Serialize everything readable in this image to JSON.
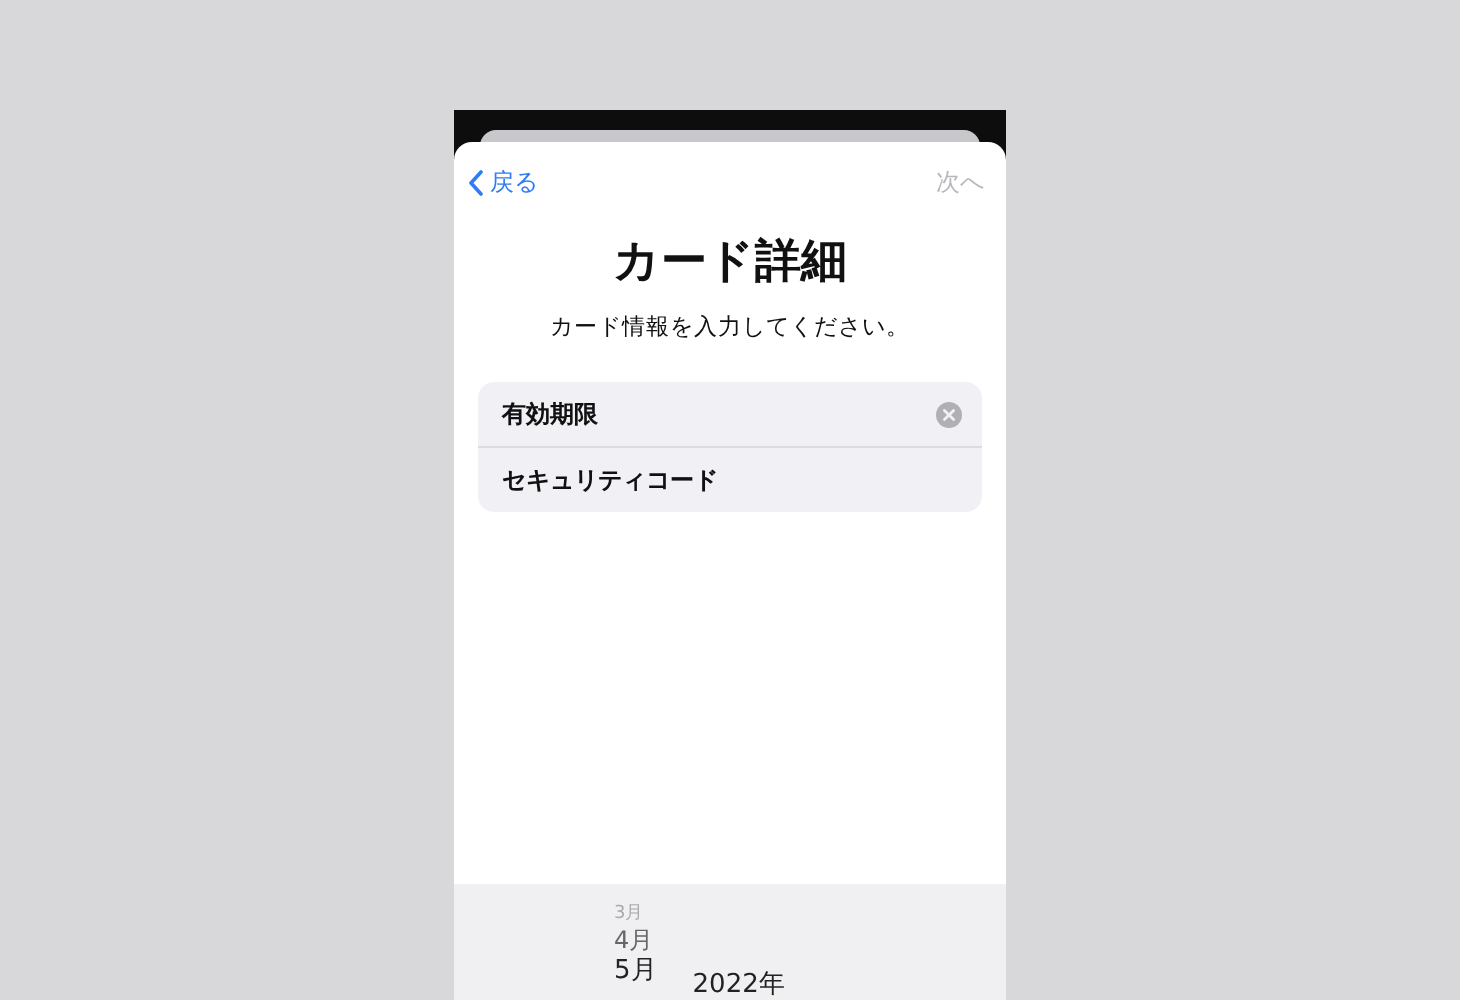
{
  "nav": {
    "back_label": "戻る",
    "next_label": "次へ",
    "next_disabled": true
  },
  "title": "カード詳細",
  "subtitle": "カード情報を入力してください。",
  "fields": [
    {
      "label": "有効期限",
      "clearable": true
    },
    {
      "label": "セキュリティコード",
      "clearable": false
    }
  ],
  "picker": {
    "months": [
      {
        "label": "3月",
        "selected": false
      },
      {
        "label": "4月",
        "selected": false
      },
      {
        "label": "5月",
        "selected": true
      }
    ],
    "year": "2022年"
  }
}
